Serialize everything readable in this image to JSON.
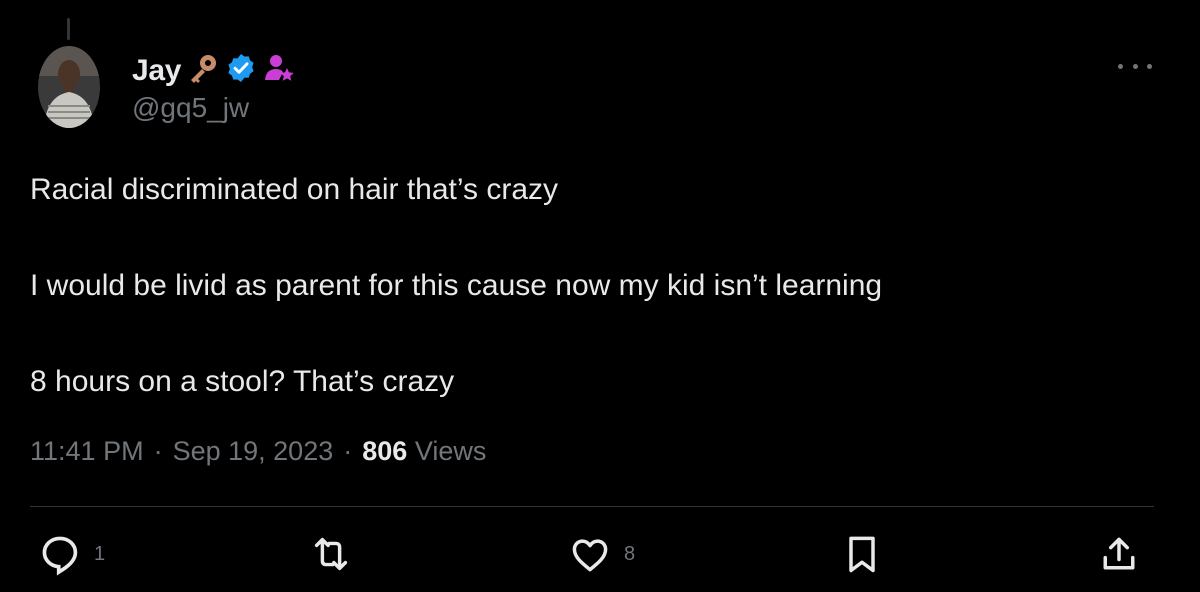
{
  "author": {
    "name": "Jay",
    "handle": "@gq5_jw",
    "badges": [
      "key-icon",
      "verified-badge-icon",
      "user-star-icon"
    ]
  },
  "tweet": {
    "paragraphs": [
      "Racial discriminated on hair that’s crazy",
      "I would be livid as parent for this cause now my kid isn’t learning",
      "8 hours on a stool? That’s crazy"
    ]
  },
  "meta": {
    "time": "11:41 PM",
    "separator": "·",
    "date": "Sep 19, 2023",
    "views_count": "806",
    "views_label": "Views"
  },
  "actions": {
    "reply_count": "1",
    "retweet_count": "",
    "like_count": "8"
  },
  "colors": {
    "background": "#000000",
    "text": "#e7e9ea",
    "secondary": "#71767b",
    "verified": "#1d9bf0",
    "key": "#c98c6b",
    "user_star": "#c93fd6"
  }
}
